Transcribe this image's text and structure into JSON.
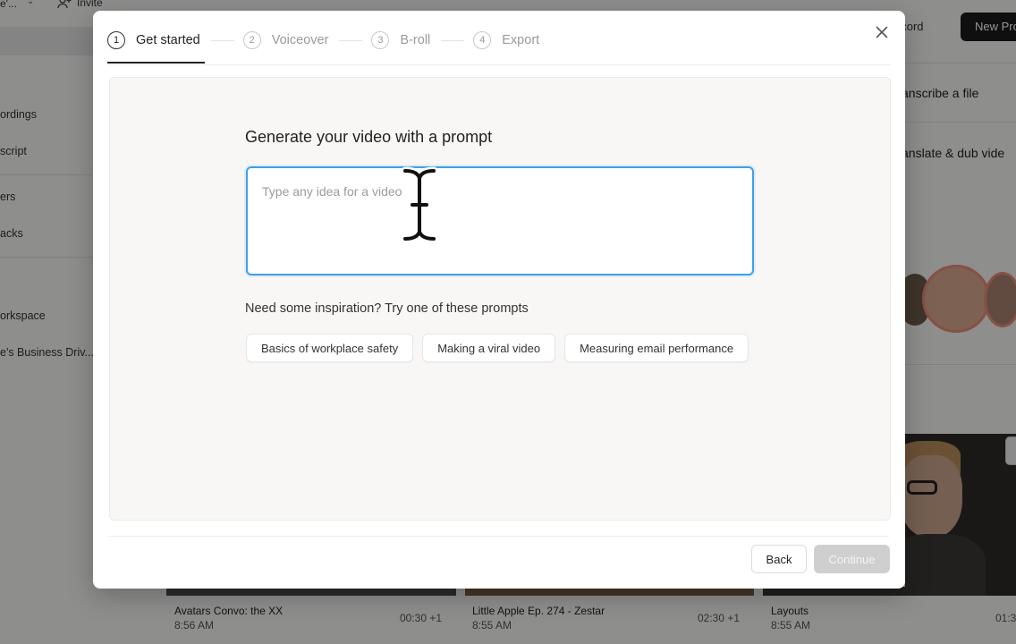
{
  "background": {
    "workspace_name": "e'...",
    "invite_label": "Invite",
    "sidebar_items": [
      "ordings",
      "script",
      "ers",
      "acks",
      "orkspace",
      "e's Business Driv..."
    ],
    "record_label": "ecord",
    "new_project_label": "New Pro",
    "actions": [
      "anscribe a file",
      "anslate & dub vide"
    ],
    "cards": [
      {
        "title": "Avatars Convo: the XX",
        "time": "8:56 AM",
        "meta": "00:30 +1"
      },
      {
        "title": "Little Apple Ep. 274 - Zestar",
        "time": "8:55 AM",
        "meta": "02:30 +1"
      },
      {
        "title": "Layouts",
        "time": "8:55 AM",
        "meta": "01:3"
      }
    ]
  },
  "modal": {
    "steps": [
      {
        "num": "1",
        "label": "Get started",
        "active": true
      },
      {
        "num": "2",
        "label": "Voiceover",
        "active": false
      },
      {
        "num": "3",
        "label": "B-roll",
        "active": false
      },
      {
        "num": "4",
        "label": "Export",
        "active": false
      }
    ],
    "title": "Generate your video with a prompt",
    "prompt_placeholder": "Type any idea for a video",
    "prompt_value": "",
    "inspiration_label": "Need some inspiration? Try one of these prompts",
    "suggestions": [
      "Basics of workplace safety",
      "Making a viral video",
      "Measuring email performance"
    ],
    "back_label": "Back",
    "continue_label": "Continue"
  },
  "colors": {
    "accent": "#3fa0ea",
    "primary_dark": "#1b1b1b",
    "disabled": "#cfcfcf"
  },
  "icons": {
    "close": "close-icon",
    "cursor": "text-cursor-icon"
  }
}
